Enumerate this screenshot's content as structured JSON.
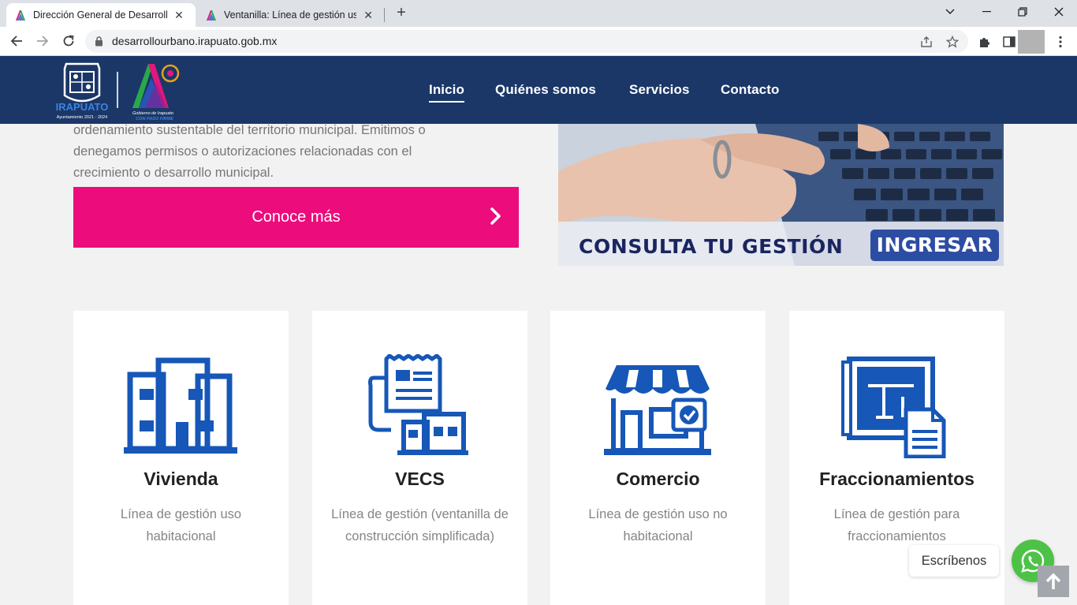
{
  "browser": {
    "tabs": [
      {
        "title": "Dirección General de Desarrollo U",
        "active": true
      },
      {
        "title": "Ventanilla: Línea de gestión uso h",
        "active": false
      }
    ],
    "url": "desarrollourbano.irapuato.gob.mx"
  },
  "header": {
    "logo_city": "IRAPUATO",
    "logo_period": "Ayuntamiento 2021 - 2024",
    "logo_gov_line1": "Gobierno de Irapuato",
    "logo_gov_line2": "CON PASO FIRME",
    "nav": [
      {
        "label": "Inicio",
        "active": true
      },
      {
        "label": "Quiénes somos",
        "active": false
      },
      {
        "label": "Servicios",
        "active": false
      },
      {
        "label": "Contacto",
        "active": false
      }
    ]
  },
  "intro": {
    "lines": [
      "ordenamiento sustentable del territorio municipal. Emitimos o",
      "denegamos permisos o autorizaciones relacionadas con el",
      "crecimiento o desarrollo municipal."
    ],
    "cta_label": "Conoce más"
  },
  "banner": {
    "text": "CONSULTA TU GESTIÓN",
    "button": "INGRESAR"
  },
  "cards": [
    {
      "name": "Vivienda",
      "icon": "buildings-icon",
      "desc": "Línea de gestión uso habitacional"
    },
    {
      "name": "VECS",
      "icon": "receipt-houses-icon",
      "desc": "Línea de gestión (ventanilla de construcción simplificada)"
    },
    {
      "name": "Comercio",
      "icon": "store-icon",
      "desc": "Línea de gestión uso no habitacional"
    },
    {
      "name": "Fraccionamientos",
      "icon": "blueprint-icon",
      "desc": "Línea de gestión para fraccionamientos"
    }
  ],
  "chat": {
    "label": "Escríbenos"
  },
  "colors": {
    "header_bg": "#1b3768",
    "cta_bg": "#ec0c7c",
    "icon_blue": "#1657b8",
    "whatsapp": "#4dc247"
  }
}
